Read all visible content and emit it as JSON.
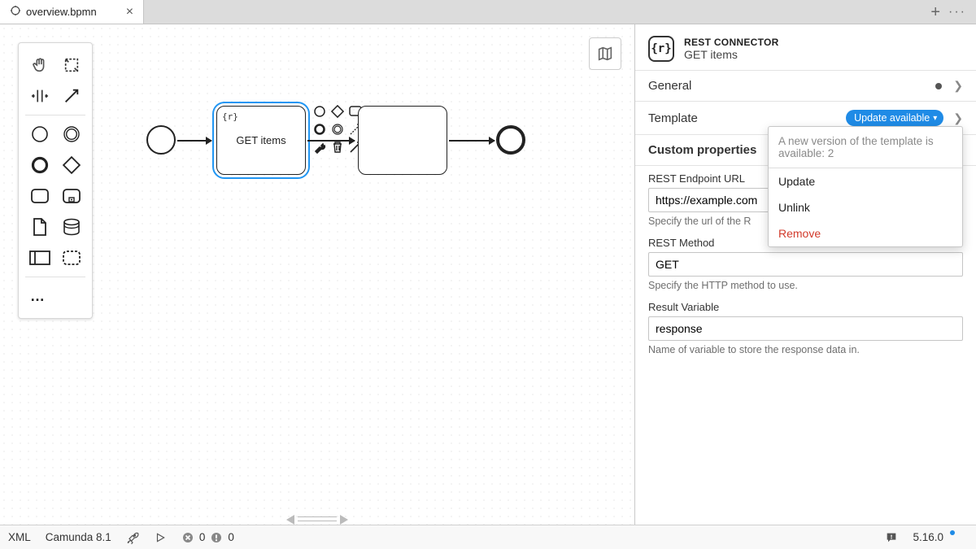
{
  "tab": {
    "title": "overview.bpmn"
  },
  "diagram": {
    "task_selected_label": "GET items"
  },
  "props": {
    "header": {
      "type_label": "REST CONNECTOR",
      "name": "GET items",
      "badge_text": "{r}"
    },
    "sections": {
      "general": {
        "label": "General"
      },
      "template": {
        "label": "Template",
        "pill_label": "Update available",
        "popup": {
          "message": "A new version of the template is available: 2",
          "update": "Update",
          "unlink": "Unlink",
          "remove": "Remove"
        }
      },
      "custom": {
        "label": "Custom properties"
      }
    },
    "fields": {
      "endpoint": {
        "label": "REST Endpoint URL",
        "value": "https://example.com",
        "hint": "Specify the url of the R"
      },
      "method": {
        "label": "REST Method",
        "value": "GET",
        "hint": "Specify the HTTP method to use."
      },
      "result": {
        "label": "Result Variable",
        "value": "response",
        "hint": "Name of variable to store the response data in."
      }
    }
  },
  "status": {
    "xml": "XML",
    "engine": "Camunda 8.1",
    "errors": "0",
    "warnings": "0",
    "version": "5.16.0"
  }
}
